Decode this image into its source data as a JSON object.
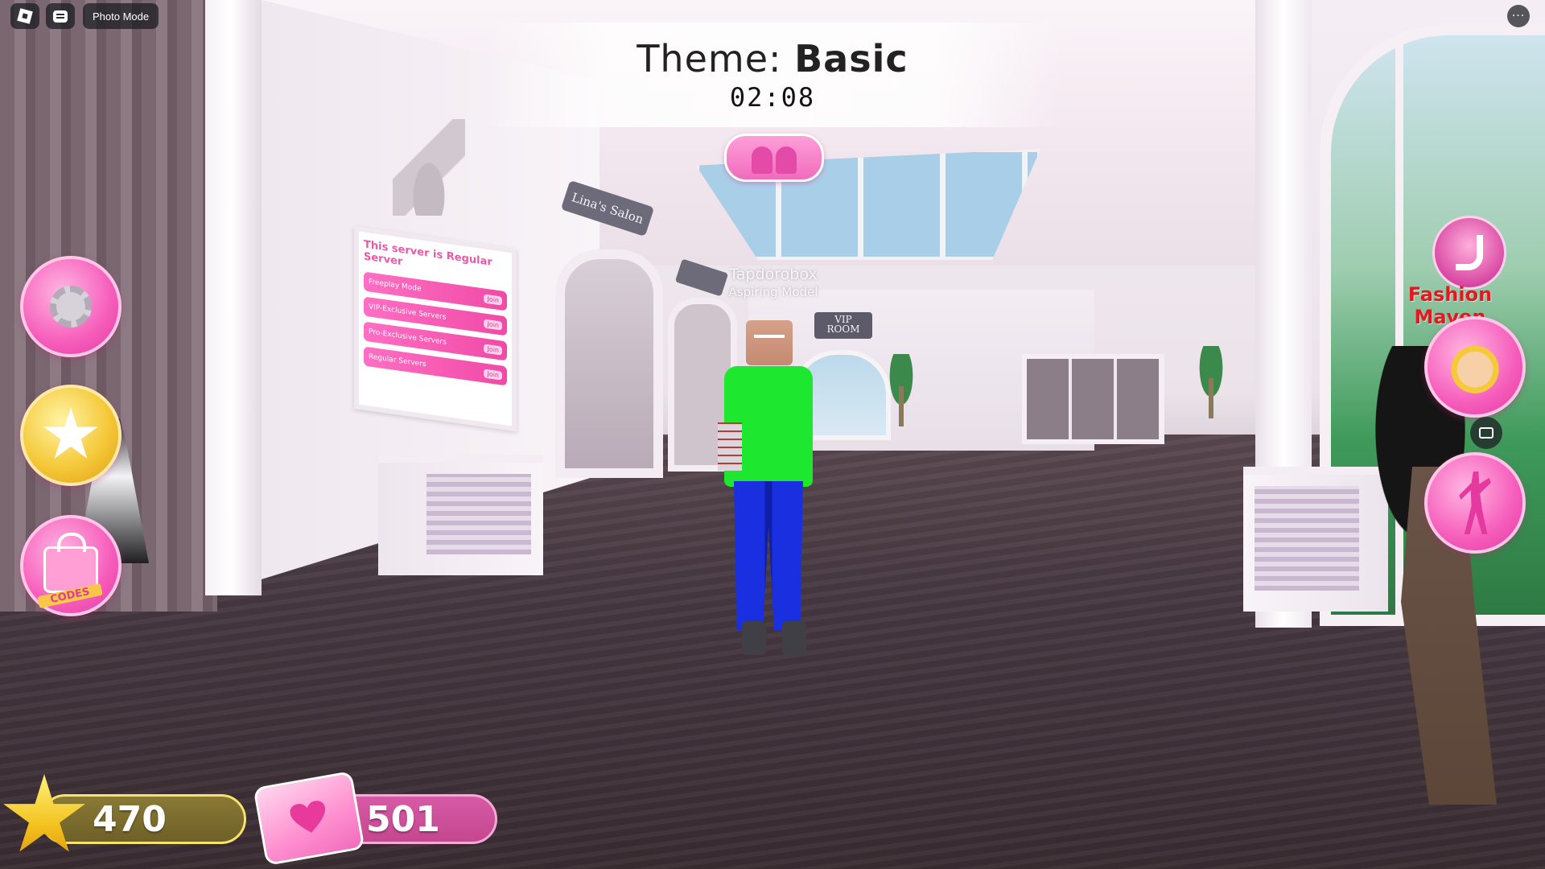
{
  "topbar": {
    "photo_mode_label": "Photo Mode"
  },
  "round": {
    "theme_label": "Theme:",
    "theme_value": "Basic",
    "timer": "02:08"
  },
  "scene": {
    "server_board": {
      "title": "This server is Regular Server",
      "rows": [
        {
          "label": "Freeplay Mode",
          "action": "Join"
        },
        {
          "label": "VIP-Exclusive Servers",
          "action": "Join"
        },
        {
          "label": "Pro-Exclusive Servers",
          "action": "Join"
        },
        {
          "label": "Regular Servers",
          "action": "Join"
        }
      ]
    },
    "salon_sign": "Lina's Salon",
    "vip_sign_line1": "VIP",
    "vip_sign_line2": "ROOM",
    "player": {
      "name": "Tapdorobox",
      "rank": "Aspiring Model"
    }
  },
  "side_menu": {
    "codes_label": "CODES"
  },
  "right_panel": {
    "title_badge": "Fashion Maven"
  },
  "currency": {
    "stars": "470",
    "cash": "501"
  },
  "icons": {
    "roblox": "roblox-logo-icon",
    "chat": "chat-icon",
    "more": "more-icon",
    "settings": "gear-icon",
    "beauty": "star-icon",
    "codes": "shopping-bag-icon",
    "duo": "duo-models-icon",
    "maven": "high-heel-icon",
    "avatar": "avatar-icon",
    "emote": "dance-icon",
    "capture": "camera-capture-icon",
    "star_currency": "star-icon",
    "cash_currency": "cash-icon"
  },
  "colors": {
    "pink_accent": "#f06cbc",
    "gold_accent": "#f5c93a",
    "maven_red": "#e8161f",
    "player_shirt": "#1de72e",
    "player_pants": "#1a2fe0"
  }
}
